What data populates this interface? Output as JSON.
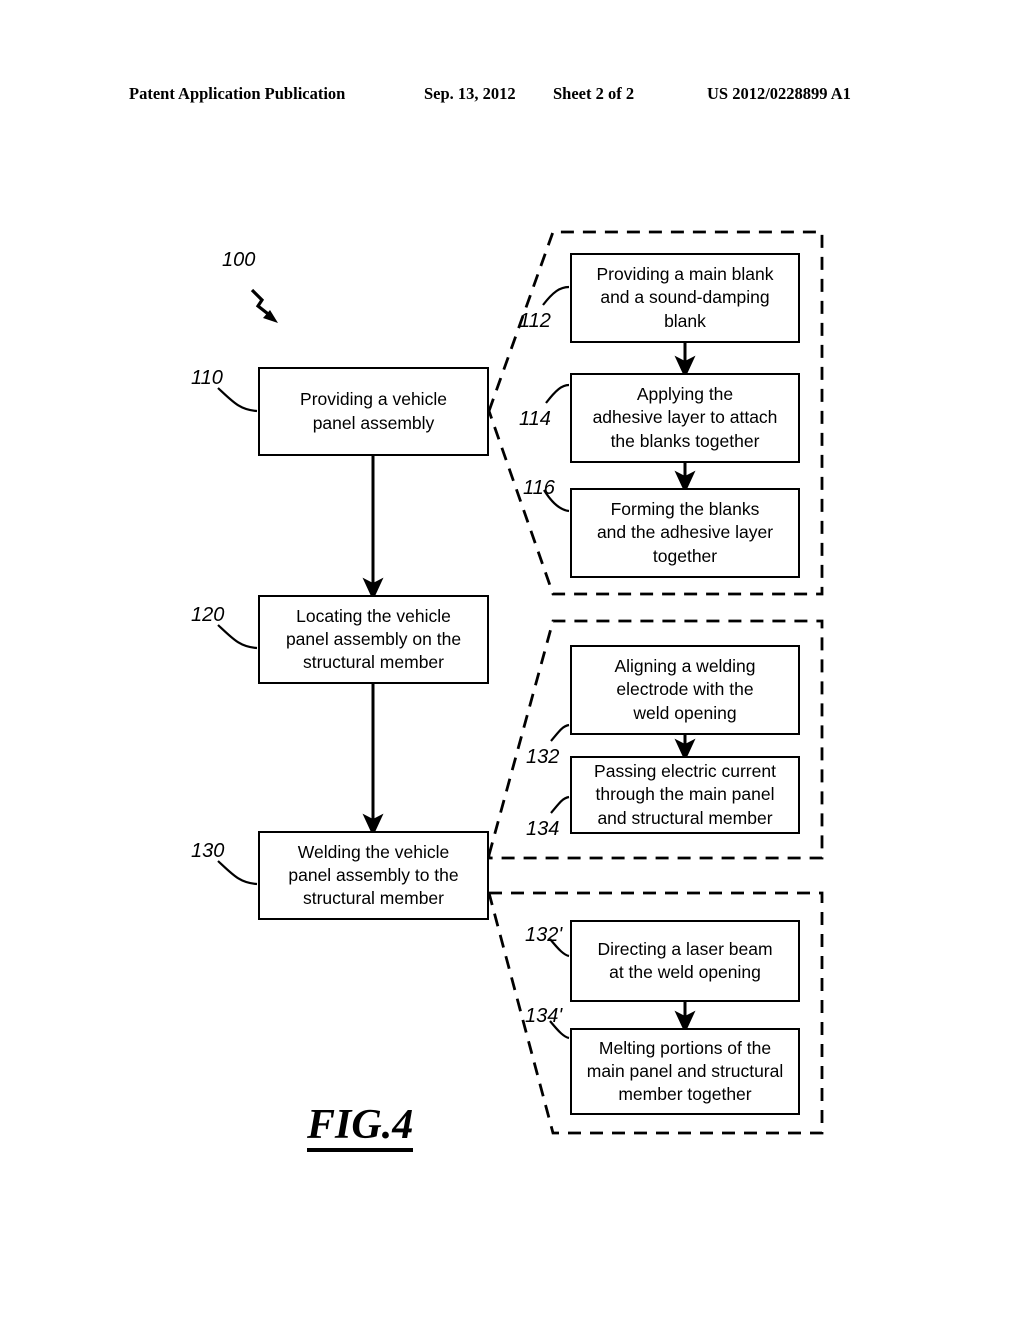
{
  "header": {
    "publication": "Patent Application Publication",
    "date": "Sep. 13, 2012",
    "sheet": "Sheet 2 of 2",
    "patent_number": "US 2012/0228899 A1"
  },
  "figure": {
    "caption": "FIG.4",
    "overall_ref": "100"
  },
  "main_steps": [
    {
      "ref": "110",
      "text": "Providing a vehicle\npanel assembly"
    },
    {
      "ref": "120",
      "text": "Locating the vehicle\npanel assembly on the\nstructural member"
    },
    {
      "ref": "130",
      "text": "Welding the vehicle\npanel assembly to the\nstructural member"
    }
  ],
  "groups": [
    {
      "name": "providing-substeps",
      "parent_ref": "110",
      "steps": [
        {
          "ref": "112",
          "text": "Providing a main blank\nand a sound-damping\nblank"
        },
        {
          "ref": "114",
          "text": "Applying the\nadhesive layer to attach\nthe blanks together"
        },
        {
          "ref": "116",
          "text": "Forming the blanks\nand the adhesive layer\ntogether"
        }
      ]
    },
    {
      "name": "resistance-welding-substeps",
      "parent_ref": "130",
      "steps": [
        {
          "ref": "132",
          "text": "Aligning a welding\nelectrode with the\nweld opening"
        },
        {
          "ref": "134",
          "text": "Passing electric current\nthrough the main panel\nand structural member"
        }
      ]
    },
    {
      "name": "laser-welding-substeps",
      "parent_ref": "130",
      "steps": [
        {
          "ref": "132'",
          "text": "Directing a laser beam\nat the weld opening"
        },
        {
          "ref": "134'",
          "text": "Melting portions of the\nmain panel and structural\nmember together"
        }
      ]
    }
  ],
  "colors": {
    "ink": "#000000",
    "paper": "#ffffff"
  }
}
